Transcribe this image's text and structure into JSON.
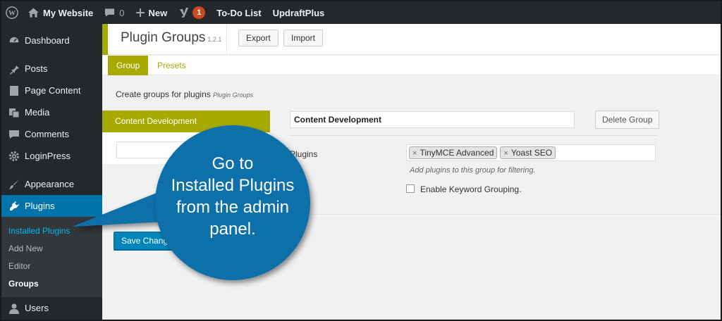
{
  "adminbar": {
    "site_name": "My Website",
    "comments_count": "0",
    "new_label": "New",
    "yoast_badge": "1",
    "todo_label": "To-Do List",
    "updraft_label": "UpdraftPlus"
  },
  "sidebar": {
    "items": [
      {
        "label": "Dashboard",
        "icon": "dashboard-icon"
      },
      {
        "label": "Posts",
        "icon": "pin-icon"
      },
      {
        "label": "Page Content",
        "icon": "page-icon"
      },
      {
        "label": "Media",
        "icon": "media-icon"
      },
      {
        "label": "Comments",
        "icon": "comment-icon"
      },
      {
        "label": "LoginPress",
        "icon": "gear-icon"
      },
      {
        "label": "Appearance",
        "icon": "brush-icon"
      },
      {
        "label": "Plugins",
        "icon": "plug-icon"
      },
      {
        "label": "Users",
        "icon": "user-icon"
      }
    ],
    "submenu": [
      "Installed Plugins",
      "Add New",
      "Editor",
      "Groups"
    ]
  },
  "header": {
    "title": "Plugin Groups",
    "version": "1.2.1",
    "export_label": "Export",
    "import_label": "Import"
  },
  "tabs": {
    "group": "Group",
    "presets": "Presets"
  },
  "main": {
    "description": "Create groups for plugins",
    "description_small": "Plugin Groups",
    "active_group": "Content Development",
    "group_name_value": "Content Development",
    "delete_label": "Delete Group",
    "plugins_label": "Plugins",
    "tags": [
      "TinyMCE Advanced",
      "Yoast SEO"
    ],
    "hint": "Add plugins to this group for filtering.",
    "checkbox_label": "Enable Keyword Grouping.",
    "save_label": "Save Changes"
  },
  "callout": {
    "line1": "Go to",
    "line2": "Installed Plugins",
    "line3": "from the admin",
    "line4": "panel.",
    "color": "#0e6fa8"
  },
  "colors": {
    "accent": "#a7aa00",
    "wp_blue": "#0073aa",
    "admin_dark": "#23282d"
  }
}
